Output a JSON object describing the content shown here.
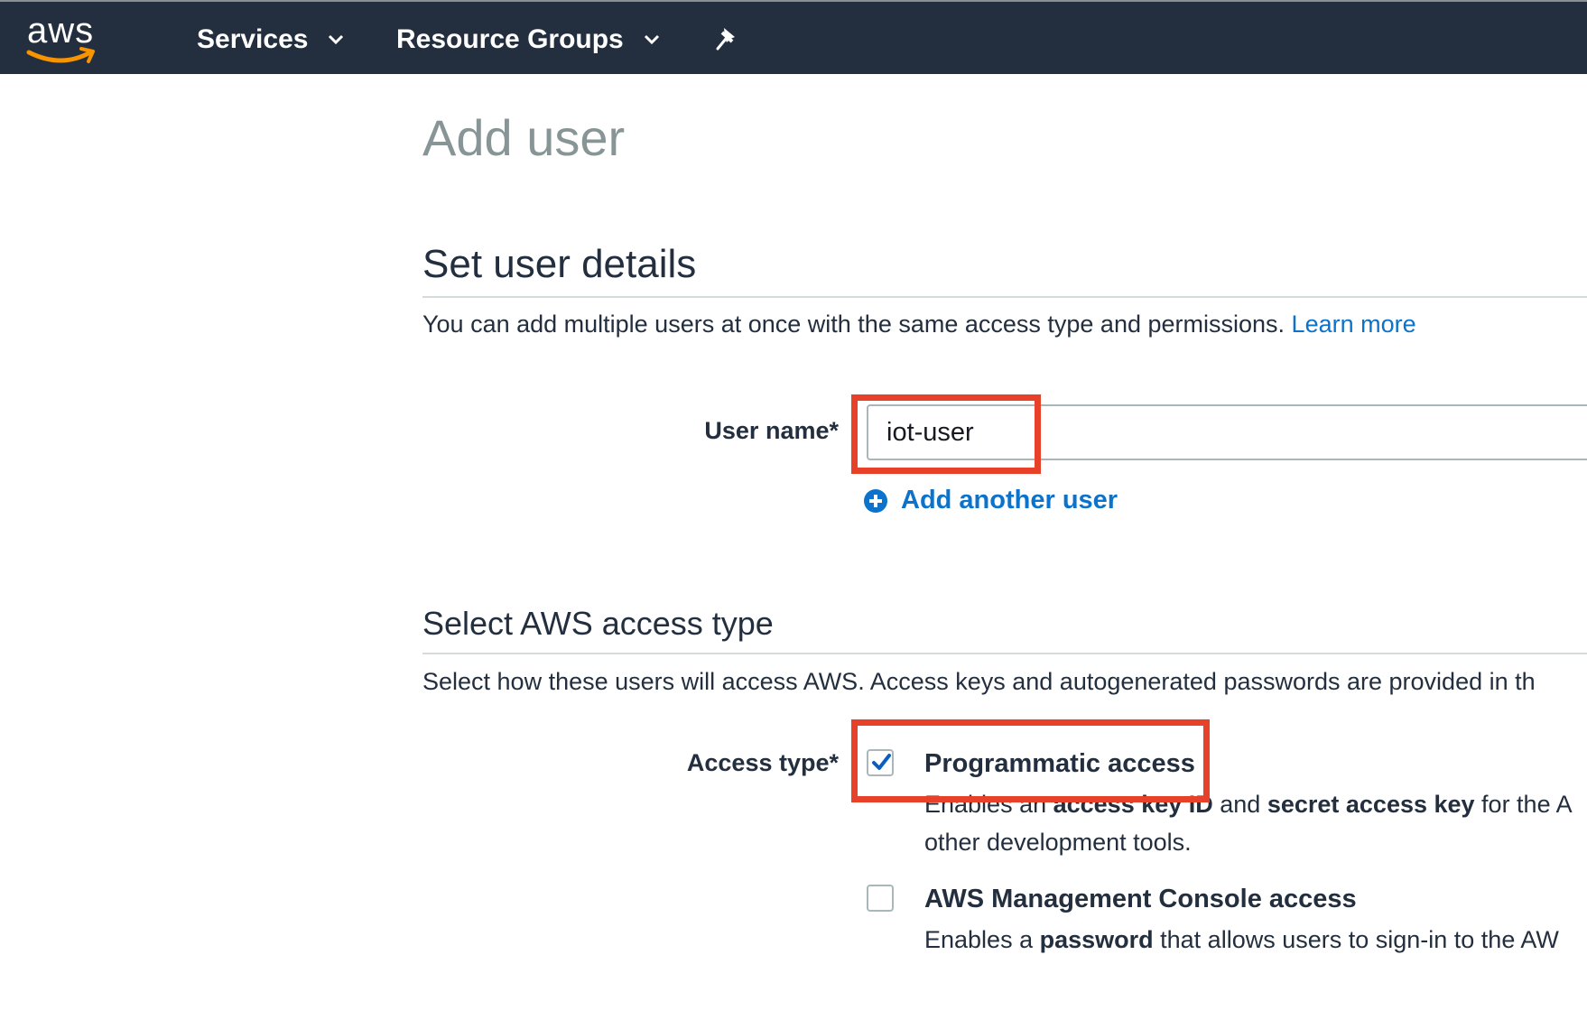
{
  "header": {
    "logo_text": "aws",
    "services_label": "Services",
    "resource_groups_label": "Resource Groups",
    "pin_icon": "pin-icon",
    "colors": {
      "bar": "#232f3e",
      "smile": "#f79400"
    }
  },
  "page": {
    "title": "Add user"
  },
  "user_details": {
    "heading": "Set user details",
    "description": "You can add multiple users at once with the same access type and permissions.",
    "learn_more": "Learn more",
    "user_name_label": "User name*",
    "user_name_value": "iot-user",
    "add_another_user": "Add another user"
  },
  "access_type": {
    "heading": "Select AWS access type",
    "description": "Select how these users will access AWS. Access keys and autogenerated passwords are provided in th",
    "label": "Access type*",
    "options": [
      {
        "title": "Programmatic access",
        "checked": true,
        "desc_line1_a": "Enables an ",
        "desc_line1_b": "access key ID",
        "desc_line1_c": " and ",
        "desc_line1_d": "secret access key",
        "desc_line1_e": " for the A",
        "desc_line2": "other development tools."
      },
      {
        "title": "AWS Management Console access",
        "checked": false,
        "desc_a": "Enables a ",
        "desc_b": "password",
        "desc_c": " that allows users to sign-in to the AW"
      }
    ]
  },
  "highlight_color": "#e8412a"
}
